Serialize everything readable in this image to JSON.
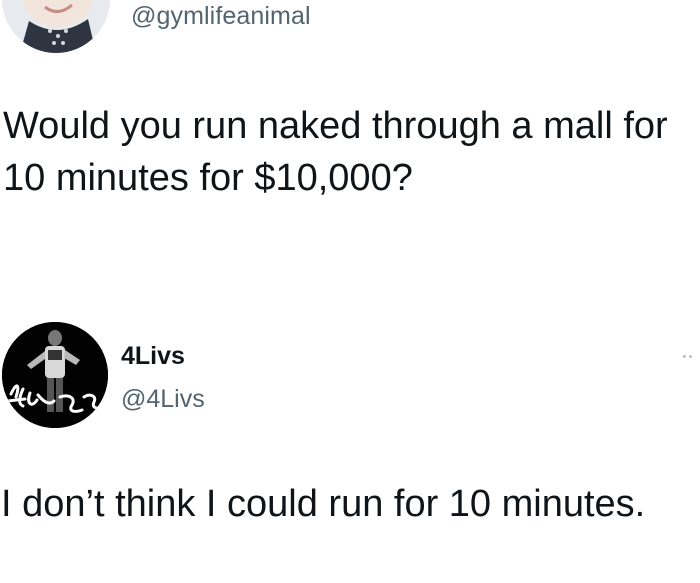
{
  "original_tweet": {
    "handle": "@gymlifeanimal",
    "text": "Would you run naked through a mall for 10 minutes for $10,000?"
  },
  "reply_tweet": {
    "display_name": "4Livs",
    "handle": "@4Livs",
    "avatar_signature": "4Livs",
    "text": "I don’t think I could run for 10 minutes."
  },
  "icons": {
    "more": "more-options-icon"
  }
}
